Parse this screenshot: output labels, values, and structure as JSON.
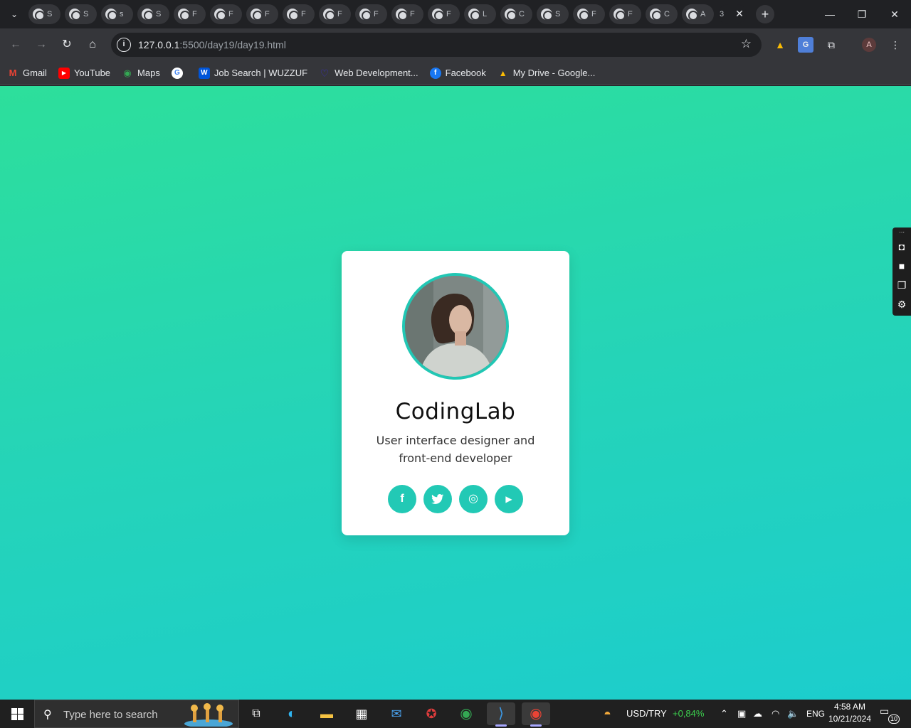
{
  "browser": {
    "tabs": [
      {
        "letter": "S"
      },
      {
        "letter": "S"
      },
      {
        "letter": "s"
      },
      {
        "letter": "S"
      },
      {
        "letter": "F"
      },
      {
        "letter": "F"
      },
      {
        "letter": "F"
      },
      {
        "letter": "F"
      },
      {
        "letter": "F"
      },
      {
        "letter": "F"
      },
      {
        "letter": "F"
      },
      {
        "letter": "F"
      },
      {
        "letter": "L"
      },
      {
        "letter": "C"
      },
      {
        "letter": "S"
      },
      {
        "letter": "F"
      },
      {
        "letter": "F"
      },
      {
        "letter": "C"
      },
      {
        "letter": "A"
      }
    ],
    "active_tab": {
      "letter": "3"
    },
    "url_host": "127.0.0.1",
    "url_path": ":5500/day19/day19.html",
    "profile_initial": "A"
  },
  "bookmarks": [
    {
      "label": "Gmail",
      "icon": "gmail-icon",
      "color": "#ea4335",
      "glyph": "M"
    },
    {
      "label": "YouTube",
      "icon": "youtube-icon",
      "color": "#ff0000",
      "glyph": "▶"
    },
    {
      "label": "Maps",
      "icon": "maps-icon",
      "color": "#34a853",
      "glyph": "◉"
    },
    {
      "label": "",
      "icon": "google-icon",
      "color": "#4285f4",
      "glyph": "G"
    },
    {
      "label": "Job Search | WUZZUF",
      "icon": "wuzzuf-icon",
      "color": "#0055d9",
      "glyph": "W"
    },
    {
      "label": "Web Development...",
      "icon": "web-dev-icon",
      "color": "#3b2fc9",
      "glyph": "♡"
    },
    {
      "label": "Facebook",
      "icon": "facebook-icon",
      "color": "#1877f2",
      "glyph": "f"
    },
    {
      "label": "My Drive - Google...",
      "icon": "drive-icon",
      "color": "#fbbc04",
      "glyph": "▲"
    }
  ],
  "card": {
    "name": "CodingLab",
    "job": "User interface designer and front-end developer",
    "socials": [
      {
        "icon": "facebook-icon",
        "glyph": "f"
      },
      {
        "icon": "twitter-icon",
        "glyph": "t"
      },
      {
        "icon": "instagram-icon",
        "glyph": "◎"
      },
      {
        "icon": "youtube-icon",
        "glyph": "▶"
      }
    ]
  },
  "taskbar": {
    "search_placeholder": "Type here to search",
    "ticker": "USD/TRY",
    "ticker_change": "+0,84%",
    "language": "ENG",
    "time": "4:58 AM",
    "date": "10/21/2024",
    "notification_count": "10"
  },
  "colors": {
    "accent": "#22c9b5",
    "gradient_top": "#2ddf9b",
    "gradient_bottom": "#1ccdcd",
    "ticker_positive": "#3ccf4e"
  }
}
